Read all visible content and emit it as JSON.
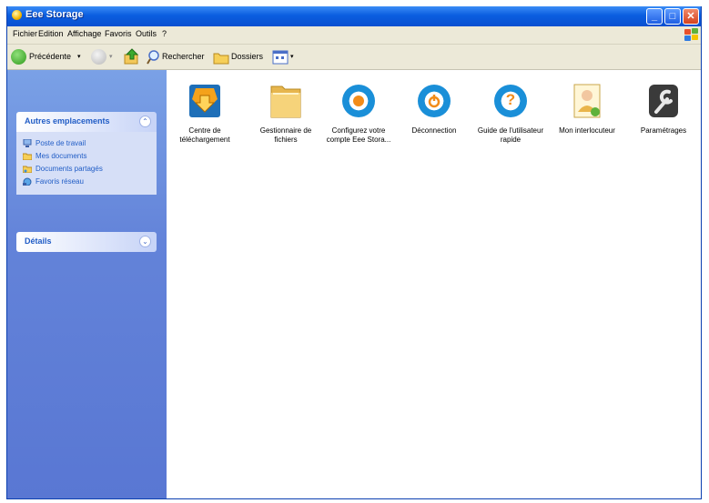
{
  "window": {
    "title": "Eee Storage"
  },
  "menu": [
    "Fichier",
    "Edition",
    "Affichage",
    "Favoris",
    "Outils",
    "?"
  ],
  "toolbar": {
    "back_label": "Précédente",
    "search_label": "Rechercher",
    "folders_label": "Dossiers"
  },
  "sidebar": {
    "other_places": {
      "title": "Autres emplacements",
      "links": [
        "Poste de travail",
        "Mes documents",
        "Documents partagés",
        "Favoris réseau"
      ]
    },
    "details": {
      "title": "Détails"
    }
  },
  "items": [
    {
      "label": "Centre de téléchargement",
      "icon": "download-center-icon"
    },
    {
      "label": "Gestionnaire de fichiers",
      "icon": "folder-icon"
    },
    {
      "label": "Configurez votre compte Eee Stora...",
      "icon": "sync-config-icon"
    },
    {
      "label": "Déconnection",
      "icon": "disconnect-icon"
    },
    {
      "label": "Guide de l'utilisateur rapide",
      "icon": "help-guide-icon"
    },
    {
      "label": "Mon interlocuteur",
      "icon": "contact-card-icon"
    },
    {
      "label": "Paramétrages",
      "icon": "wrench-settings-icon"
    }
  ],
  "colors": {
    "titlebar": "#0a5ee0",
    "sidebar": "#6383d9",
    "link": "#215dc6"
  }
}
